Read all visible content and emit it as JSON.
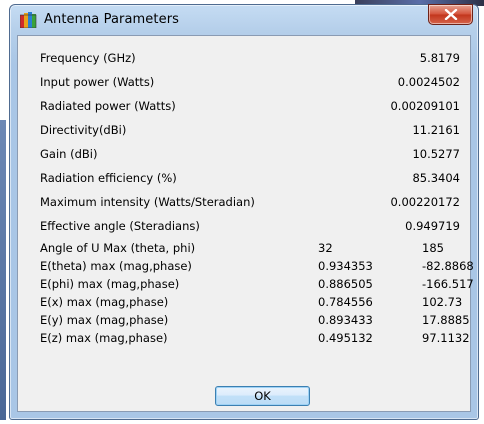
{
  "window": {
    "title": "Antenna Parameters",
    "close_icon": "close-x-icon",
    "app_icon": "antenna-app-icon"
  },
  "parameters": [
    {
      "label": "Frequency (GHz)",
      "value": "5.8179"
    },
    {
      "label": "Input power (Watts)",
      "value": "0.0024502"
    },
    {
      "label": "Radiated power (Watts)",
      "value": "0.00209101"
    },
    {
      "label": "Directivity(dBi)",
      "value": "11.2161"
    },
    {
      "label": "Gain (dBi)",
      "value": "10.5277"
    },
    {
      "label": "Radiation efficiency (%)",
      "value": "85.3404"
    },
    {
      "label": "Maximum intensity (Watts/Steradian)",
      "value": "0.00220172"
    },
    {
      "label": "Effective angle (Steradians)",
      "value": "0.949719"
    }
  ],
  "field_parameters": [
    {
      "label": "Angle of U Max (theta, phi)",
      "value1": "32",
      "value2": "185"
    },
    {
      "label": "E(theta) max (mag,phase)",
      "value1": "0.934353",
      "value2": "-82.8868"
    },
    {
      "label": "E(phi) max (mag,phase)",
      "value1": "0.886505",
      "value2": "-166.517"
    },
    {
      "label": "E(x) max (mag,phase)",
      "value1": "0.784556",
      "value2": "102.73"
    },
    {
      "label": "E(y) max (mag,phase)",
      "value1": "0.893433",
      "value2": "17.8885"
    },
    {
      "label": "E(z) max (mag,phase)",
      "value1": "0.495132",
      "value2": "97.1132"
    }
  ],
  "buttons": {
    "ok_label": "OK"
  },
  "colors": {
    "window_frame": "#a9c6e6",
    "client_bg": "#f0f0f0",
    "close_button": "#c2361d",
    "ok_border": "#3c7fb1"
  }
}
